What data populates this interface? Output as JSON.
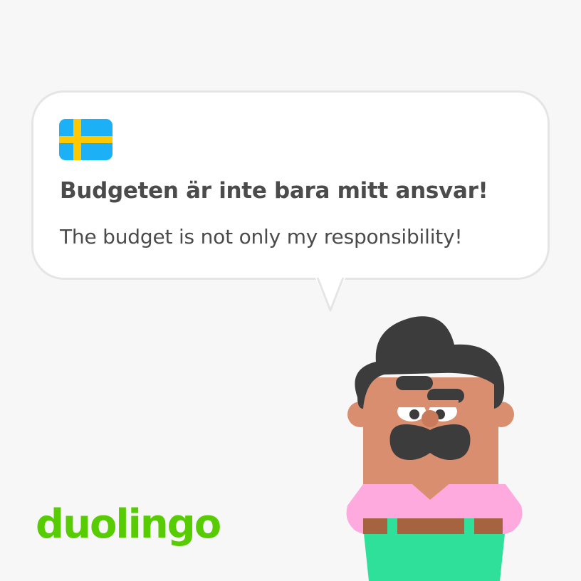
{
  "card": {
    "language_flag": "sweden-flag-icon",
    "sentence": "Budgeten är inte bara mitt ansvar!",
    "translation": "The budget is not only my responsibility!"
  },
  "brand": {
    "logo_text": "duolingo",
    "logo_color": "#58cc02"
  },
  "colors": {
    "background": "#f7f7f7",
    "bubble_fill": "#ffffff",
    "bubble_border": "#e5e5e5",
    "text": "#4b4b4b",
    "flag_blue": "#1cb0f6",
    "flag_yellow": "#ffc800"
  },
  "character": {
    "icon": "oscar-character-icon",
    "skin": "#d98e6f",
    "hair": "#3c3c3c",
    "shirt": "#ffaadf",
    "pants": "#2fe09b",
    "belt": "#a5633f"
  }
}
